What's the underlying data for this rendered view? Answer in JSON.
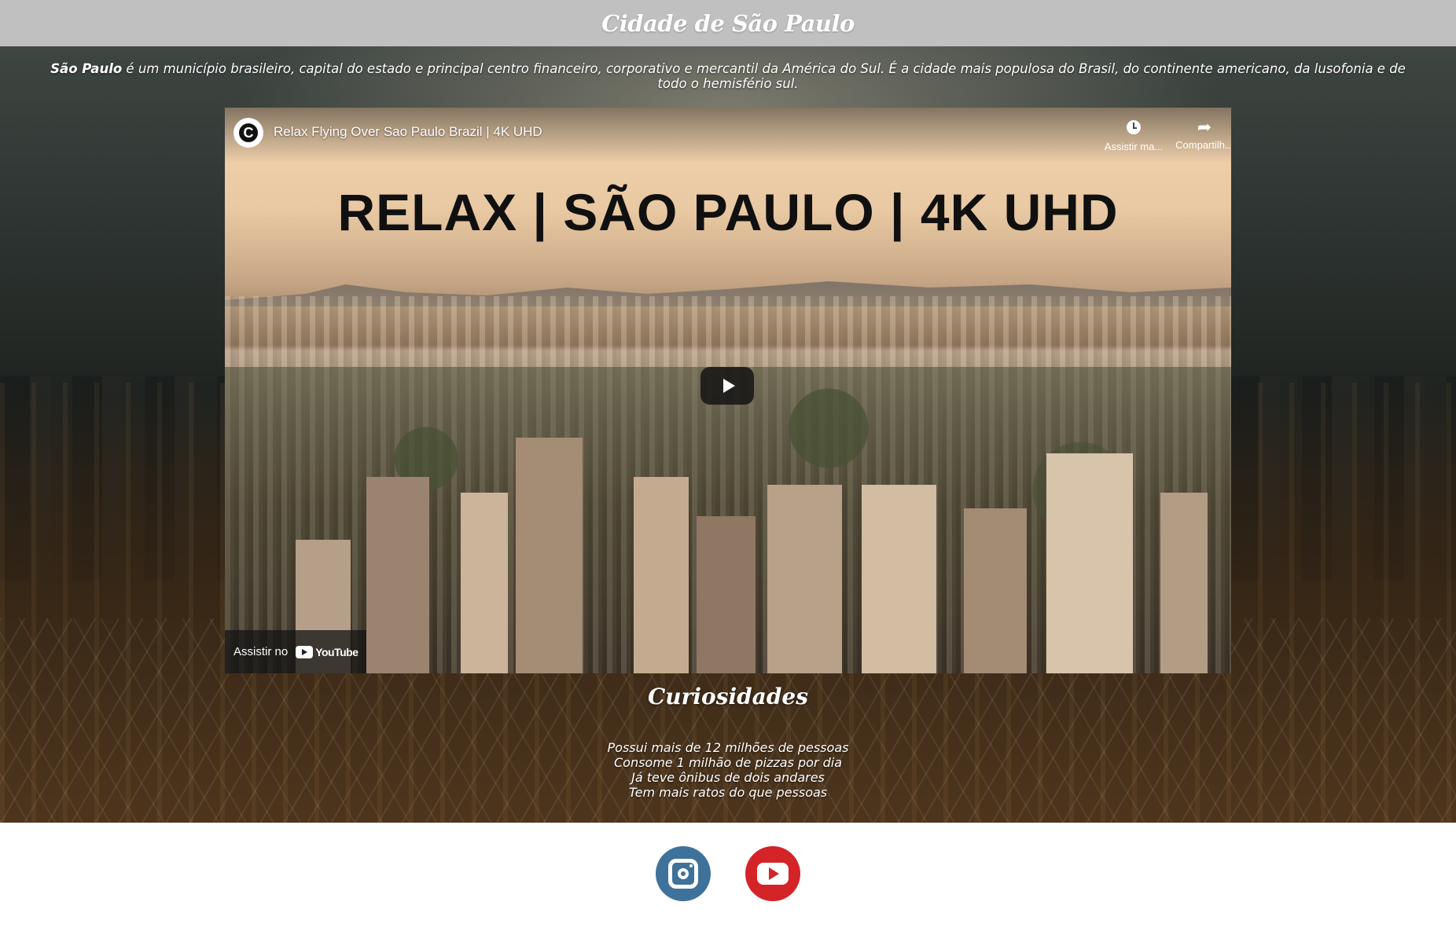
{
  "header": {
    "title": "Cidade de São Paulo"
  },
  "intro": {
    "bold": "São Paulo",
    "text": " é um município brasileiro, capital do estado e principal centro financeiro, corporativo e mercantil da América do Sul. É a cidade mais populosa do Brasil, do continente americano, da lusofonia e de todo o hemisfério sul."
  },
  "video": {
    "channel_icon": "channel-c-logo-icon",
    "title": "Relax Flying Over Sao Paulo Brazil | 4K UHD",
    "heading": "RELAX | SÃO PAULO | 4K UHD",
    "actions": [
      {
        "label": "Assistir ma...",
        "icon": "clock-icon"
      },
      {
        "label": "Compartilh...",
        "icon": "share-icon"
      }
    ],
    "watch_on_label": "Assistir no",
    "youtube_word": "YouTube"
  },
  "curiosidades": {
    "title": "Curiosidades",
    "items": [
      "Possui mais de 12 milhões de pessoas",
      "Consome 1 milhão de pizzas por dia",
      "Já teve ônibus de dois andares",
      "Tem mais ratos do que pessoas"
    ]
  },
  "footer": {
    "social": [
      {
        "name": "instagram",
        "icon": "instagram-icon",
        "color": "#3f729b"
      },
      {
        "name": "youtube",
        "icon": "youtube-icon",
        "color": "#d42428"
      }
    ]
  },
  "colors": {
    "header_bg": "#c0c0c0",
    "page_bg": "#ffffff"
  }
}
